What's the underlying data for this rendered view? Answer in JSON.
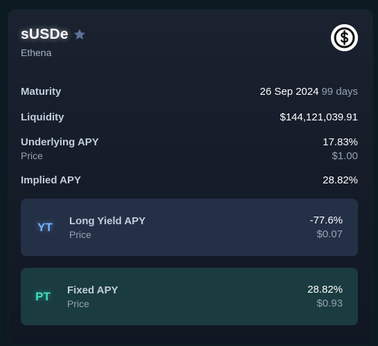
{
  "token": {
    "name": "sUSDe",
    "issuer": "Ethena",
    "logo_icon": "dollar-coin-icon",
    "favorite_icon": "star-icon"
  },
  "stats": {
    "maturity": {
      "label": "Maturity",
      "date": "26 Sep 2024",
      "days": "99 days"
    },
    "liquidity": {
      "label": "Liquidity",
      "value": "$144,121,039.91"
    },
    "underlying": {
      "label": "Underlying APY",
      "value": "17.83%",
      "price_label": "Price",
      "price": "$1.00"
    },
    "implied": {
      "label": "Implied APY",
      "value": "28.82%"
    }
  },
  "yt": {
    "badge": "YT",
    "label": "Long Yield APY",
    "price_label": "Price",
    "apy": "-77.6%",
    "price": "$0.07"
  },
  "pt": {
    "badge": "PT",
    "label": "Fixed APY",
    "price_label": "Price",
    "apy": "28.82%",
    "price": "$0.93"
  },
  "colors": {
    "yt_accent": "#76b3ff",
    "pt_accent": "#3fe0c2",
    "yt_panel": "#243046",
    "pt_panel": "#1a3b3f"
  }
}
